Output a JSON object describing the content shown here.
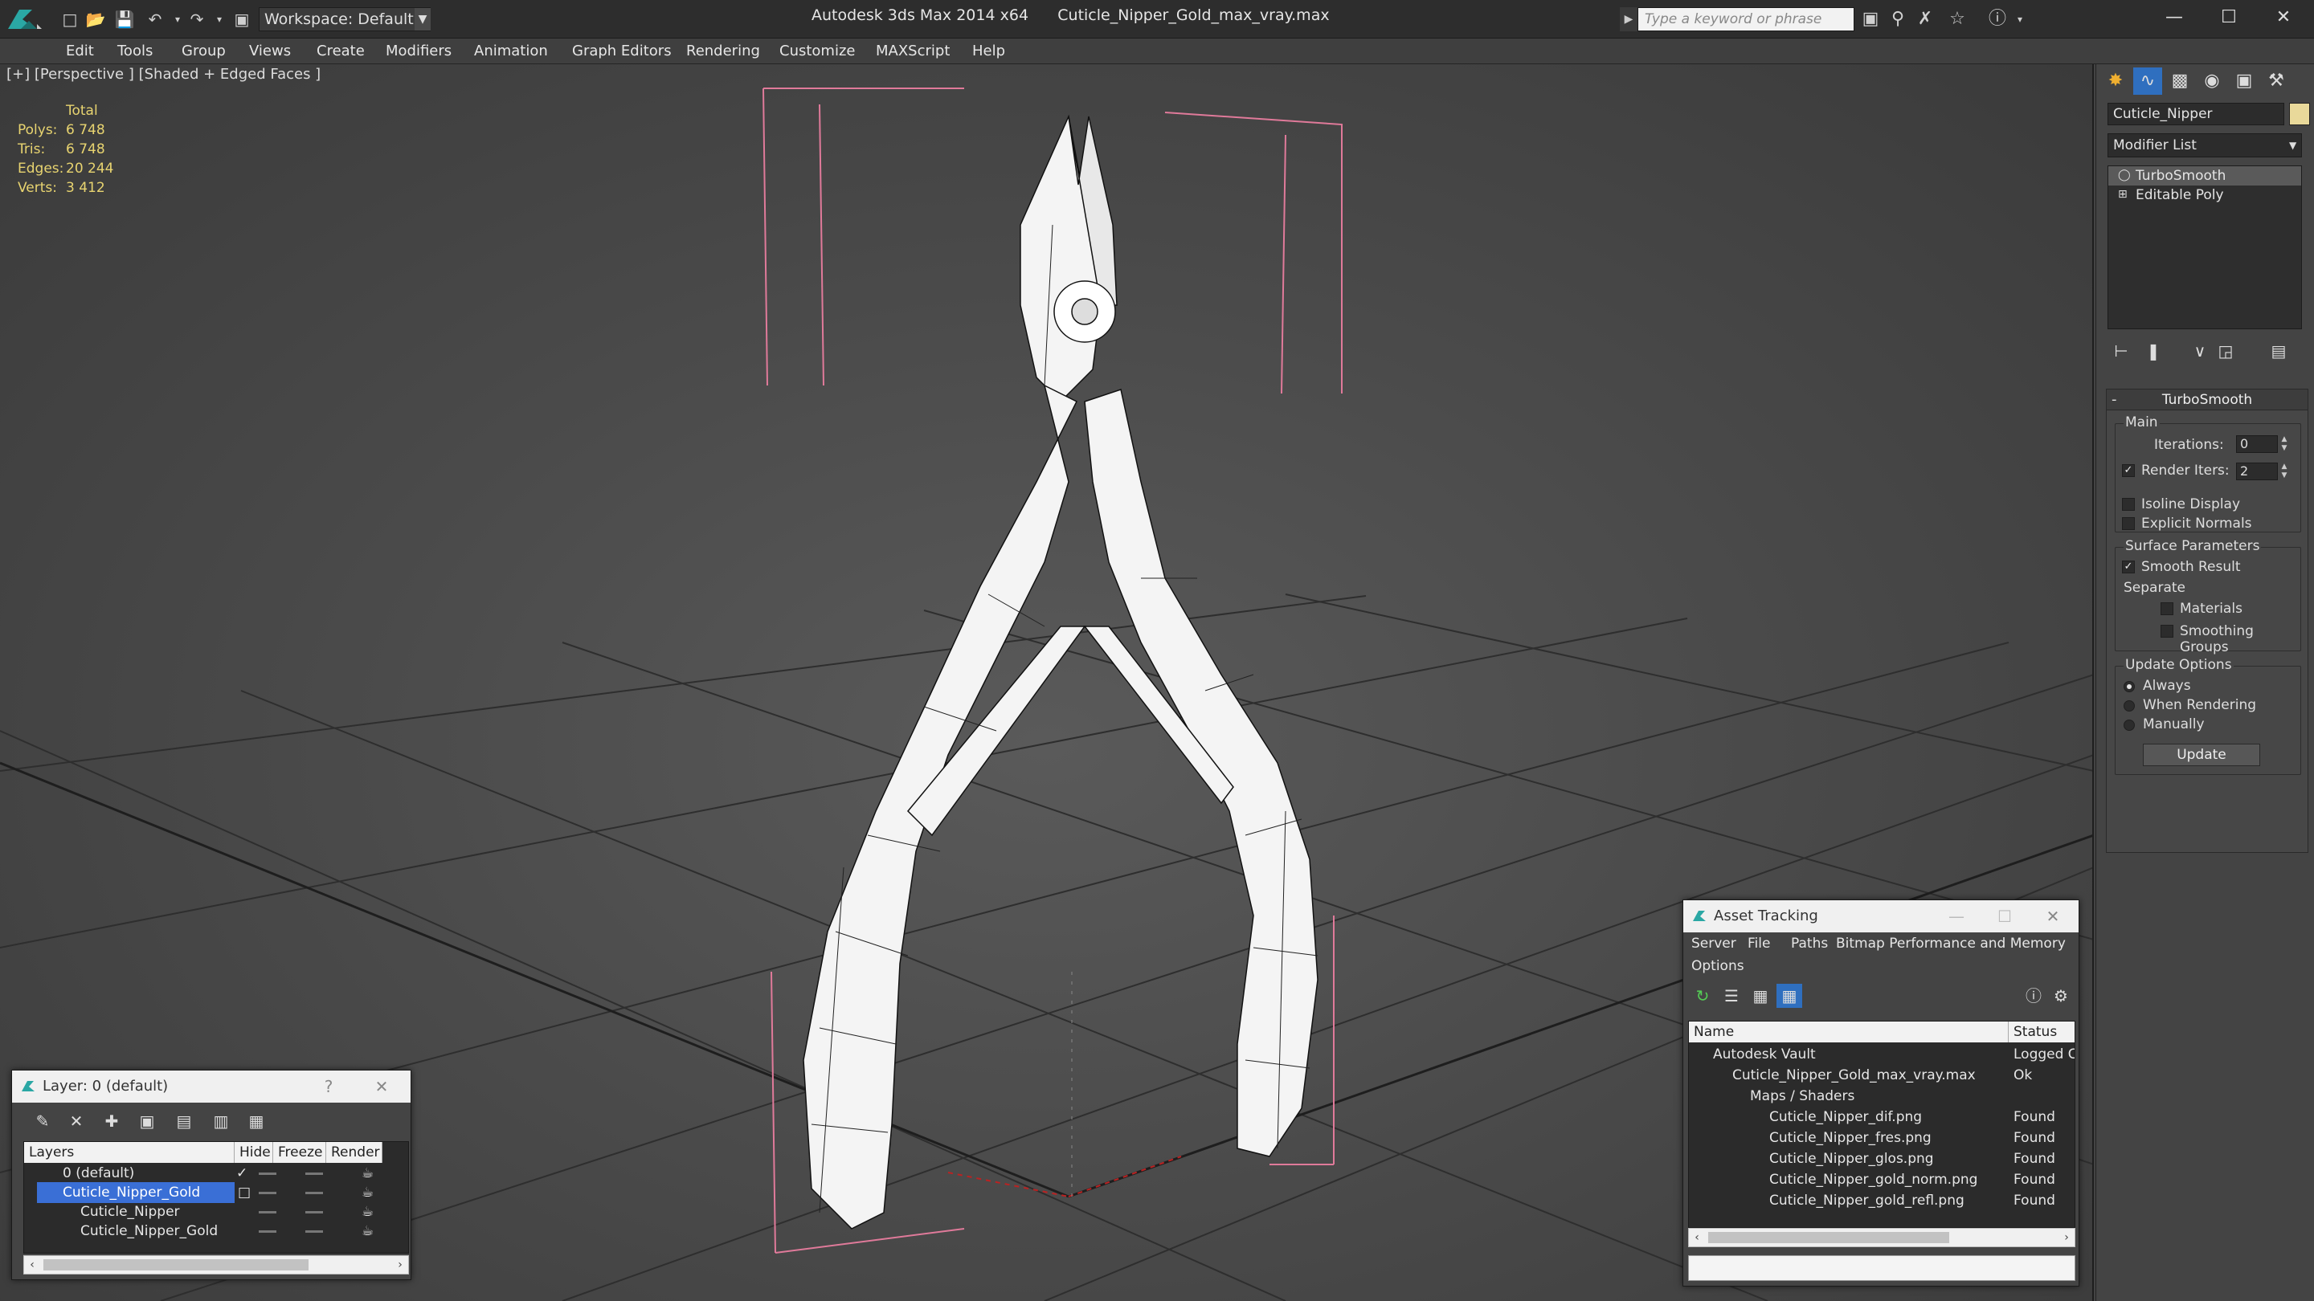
{
  "titlebar": {
    "workspace": "Workspace: Default",
    "title": "Autodesk 3ds Max 2014 x64      Cuticle_Nipper_Gold_max_vray.max",
    "search_placeholder": "Type a keyword or phrase"
  },
  "menu": [
    "Edit",
    "Tools",
    "Group",
    "Views",
    "Create",
    "Modifiers",
    "Animation",
    "Graph Editors",
    "Rendering",
    "Customize",
    "MAXScript",
    "Help"
  ],
  "viewport": {
    "label": "[+] [Perspective ] [Shaded + Edged Faces ]",
    "stats": {
      "header": "Total",
      "rows": [
        {
          "label": "Polys:",
          "value": "6 748"
        },
        {
          "label": "Tris:",
          "value": "6 748"
        },
        {
          "label": "Edges:",
          "value": "20 244"
        },
        {
          "label": "Verts:",
          "value": "3 412"
        }
      ]
    }
  },
  "command_panel": {
    "object_name": "Cuticle_Nipper",
    "object_color": "#e9d99a",
    "modifier_list": "Modifier List",
    "stack": [
      "TurboSmooth",
      "Editable Poly"
    ],
    "rollout_title": "TurboSmooth",
    "main_group": "Main",
    "iterations_label": "Iterations:",
    "iterations_value": "0",
    "render_iters_label": "Render Iters:",
    "render_iters_value": "2",
    "render_iters_checked": true,
    "isoline_label": "Isoline Display",
    "explicit_normals_label": "Explicit Normals",
    "surface_group": "Surface Parameters",
    "smooth_result_label": "Smooth Result",
    "smooth_result_checked": true,
    "separate_label": "Separate",
    "materials_label": "Materials",
    "smoothing_groups_label": "Smoothing Groups",
    "update_group": "Update Options",
    "update_always": "Always",
    "update_rendering": "When Rendering",
    "update_manually": "Manually",
    "update_button": "Update"
  },
  "layer_window": {
    "title": "Layer: 0 (default)",
    "help": "?",
    "columns": [
      "Layers",
      "Hide",
      "Freeze",
      "Render"
    ],
    "rows": [
      {
        "name": "0 (default)",
        "indent": 1,
        "active": true
      },
      {
        "name": "Cuticle_Nipper_Gold",
        "indent": 1,
        "selected": true
      },
      {
        "name": "Cuticle_Nipper",
        "indent": 2
      },
      {
        "name": "Cuticle_Nipper_Gold",
        "indent": 2
      }
    ]
  },
  "asset_window": {
    "title": "Asset Tracking",
    "menu": [
      "Server",
      "File",
      "Paths",
      "Bitmap Performance and Memory",
      "Options"
    ],
    "columns": [
      "Name",
      "Status"
    ],
    "rows": [
      {
        "name": "Autodesk Vault",
        "status": "Logged C",
        "indent": 0
      },
      {
        "name": "Cuticle_Nipper_Gold_max_vray.max",
        "status": "Ok",
        "indent": 1
      },
      {
        "name": "Maps / Shaders",
        "status": "",
        "indent": 2
      },
      {
        "name": "Cuticle_Nipper_dif.png",
        "status": "Found",
        "indent": 3
      },
      {
        "name": "Cuticle_Nipper_fres.png",
        "status": "Found",
        "indent": 3
      },
      {
        "name": "Cuticle_Nipper_glos.png",
        "status": "Found",
        "indent": 3
      },
      {
        "name": "Cuticle_Nipper_gold_norm.png",
        "status": "Found",
        "indent": 3
      },
      {
        "name": "Cuticle_Nipper_gold_refl.png",
        "status": "Found",
        "indent": 3
      }
    ]
  }
}
